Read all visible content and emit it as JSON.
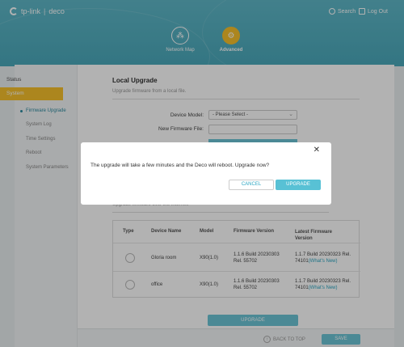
{
  "header": {
    "brand": "tp-link",
    "product": "deco",
    "search_label": "Search",
    "logout_label": "Log Out",
    "nav": [
      {
        "label": "Network Map",
        "icon": "network-map-icon"
      },
      {
        "label": "Advanced",
        "icon": "gear-icon"
      }
    ],
    "colors": {
      "header_teal": "#4aa9bb",
      "accent_yellow": "#f6c02c"
    }
  },
  "sidebar": {
    "items": [
      {
        "label": "Status"
      },
      {
        "label": "System"
      }
    ],
    "sub_items": [
      {
        "label": "Firmware Upgrade"
      },
      {
        "label": "System Log"
      },
      {
        "label": "Time Settings"
      },
      {
        "label": "Reboot"
      },
      {
        "label": "System Parameters"
      }
    ]
  },
  "local_upgrade": {
    "title": "Local Upgrade",
    "subtitle": "Upgrade firmware from a local file.",
    "device_model_label": "Device Model:",
    "device_model_value": "- Please Select -",
    "new_firmware_label": "New Firmware File:"
  },
  "online_upgrade": {
    "subtitle": "Upgrade firmware over the Internet.",
    "columns": [
      "Type",
      "Device Name",
      "Model",
      "Firmware Version",
      "Latest Firmware Version"
    ],
    "rows": [
      {
        "device_name": "Gloria room",
        "model": "X90(1.0)",
        "firmware_version": "1.1.6 Build 20230303 Rel. 55702",
        "latest_version": "1.1.7 Build 20230323 Rel. 74101",
        "whats_new": "(What's New)"
      },
      {
        "device_name": "office",
        "model": "X90(1.0)",
        "firmware_version": "1.1.6 Build 20230303 Rel. 55702",
        "latest_version": "1.1.7 Build 20230323 Rel. 74101",
        "whats_new": "(What's New)"
      }
    ],
    "upgrade_button": "UPGRADE"
  },
  "footer": {
    "back_to_top": "BACK TO TOP",
    "save": "SAVE"
  },
  "dialog": {
    "message": "The upgrade will take a few minutes and the Deco will reboot. Upgrade now?",
    "cancel": "CANCEL",
    "confirm": "UPGRADE"
  }
}
